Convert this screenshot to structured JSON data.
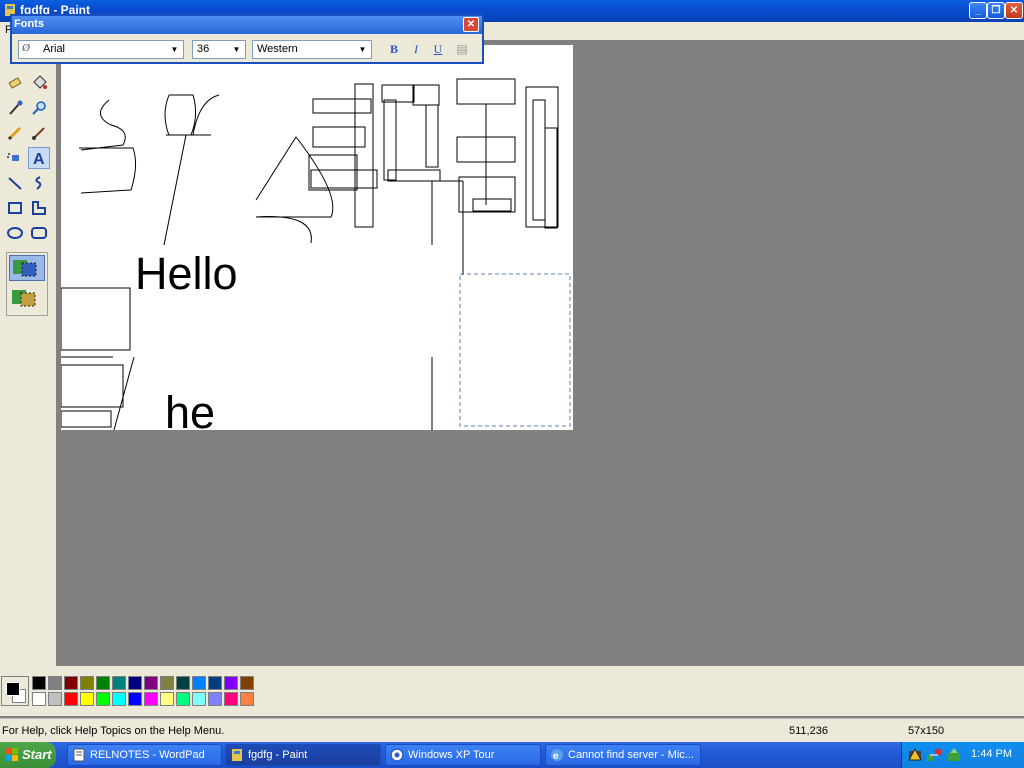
{
  "window": {
    "title": "fgdfg - Paint"
  },
  "menubar": {
    "first_letter": "F"
  },
  "fonts_toolbar": {
    "title": "Fonts",
    "font_name": "Arial",
    "font_size": "36",
    "script": "Western",
    "bold": "B",
    "italic": "I",
    "underline": "U"
  },
  "canvas": {
    "text_hello": "Hello",
    "text_partial": "he"
  },
  "palette": {
    "colors_row1": [
      "#000000",
      "#808080",
      "#800000",
      "#808000",
      "#008000",
      "#008080",
      "#000080",
      "#800080",
      "#808040",
      "#004040",
      "#0080ff",
      "#004080",
      "#8000ff",
      "#804000"
    ],
    "colors_row2": [
      "#ffffff",
      "#c0c0c0",
      "#ff0000",
      "#ffff00",
      "#00ff00",
      "#00ffff",
      "#0000ff",
      "#ff00ff",
      "#ffff80",
      "#00ff80",
      "#80ffff",
      "#8080ff",
      "#ff0080",
      "#ff8040"
    ],
    "foreground": "#000000",
    "background": "#ffffff"
  },
  "statusbar": {
    "help_text": "For Help, click Help Topics on the Help Menu.",
    "cursor_pos": "511,236",
    "selection_size": "57x150"
  },
  "taskbar": {
    "start_label": "Start",
    "items": [
      {
        "label": "RELNOTES - WordPad"
      },
      {
        "label": "fgdfg - Paint"
      },
      {
        "label": "Windows XP Tour"
      },
      {
        "label": "Cannot find server - Mic..."
      }
    ],
    "clock": "1:44 PM"
  }
}
